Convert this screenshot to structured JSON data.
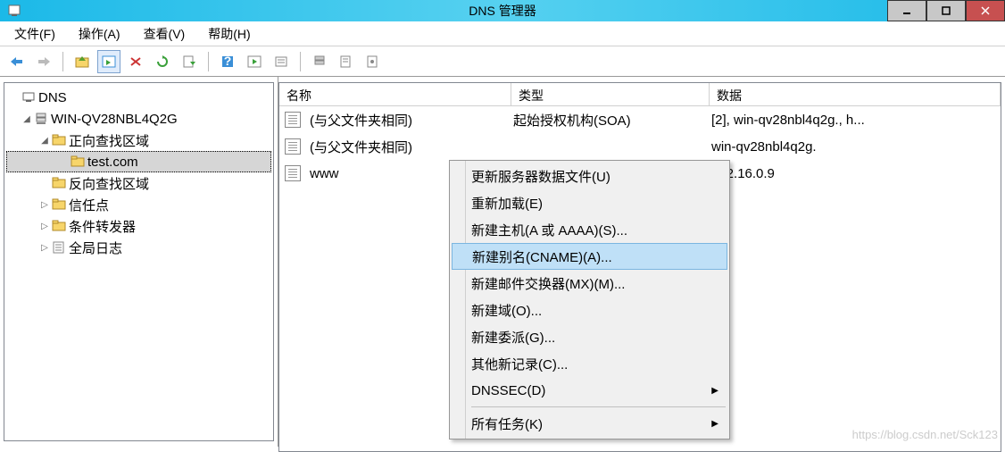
{
  "window": {
    "title": "DNS 管理器"
  },
  "menubar": [
    "文件(F)",
    "操作(A)",
    "查看(V)",
    "帮助(H)"
  ],
  "tree": {
    "root": "DNS",
    "server": "WIN-QV28NBL4Q2G",
    "nodes": {
      "fwd_zone": "正向查找区域",
      "test_zone": "test.com",
      "rev_zone": "反向查找区域",
      "trust": "信任点",
      "cond_fwd": "条件转发器",
      "global_log": "全局日志"
    }
  },
  "columns": {
    "name": "名称",
    "type": "类型",
    "data": "数据"
  },
  "rows": [
    {
      "name": "(与父文件夹相同)",
      "type": "起始授权机构(SOA)",
      "data": "[2], win-qv28nbl4q2g., h..."
    },
    {
      "name": "(与父文件夹相同)",
      "type": "",
      "data": "win-qv28nbl4q2g."
    },
    {
      "name": "www",
      "type": "",
      "data": "172.16.0.9"
    }
  ],
  "context_menu": {
    "items": [
      {
        "label": "更新服务器数据文件(U)",
        "sep": false
      },
      {
        "label": "重新加载(E)",
        "sep": false
      },
      {
        "label": "新建主机(A 或 AAAA)(S)...",
        "sep": false
      },
      {
        "label": "新建别名(CNAME)(A)...",
        "sep": false,
        "highlight": true
      },
      {
        "label": "新建邮件交换器(MX)(M)...",
        "sep": false
      },
      {
        "label": "新建域(O)...",
        "sep": false
      },
      {
        "label": "新建委派(G)...",
        "sep": false
      },
      {
        "label": "其他新记录(C)...",
        "sep": false
      },
      {
        "label": "DNSSEC(D)",
        "sep": false,
        "sub": true
      },
      {
        "sep": true
      },
      {
        "label": "所有任务(K)",
        "sep": false,
        "sub": true
      }
    ]
  },
  "watermark": "https://blog.csdn.net/Sck123"
}
